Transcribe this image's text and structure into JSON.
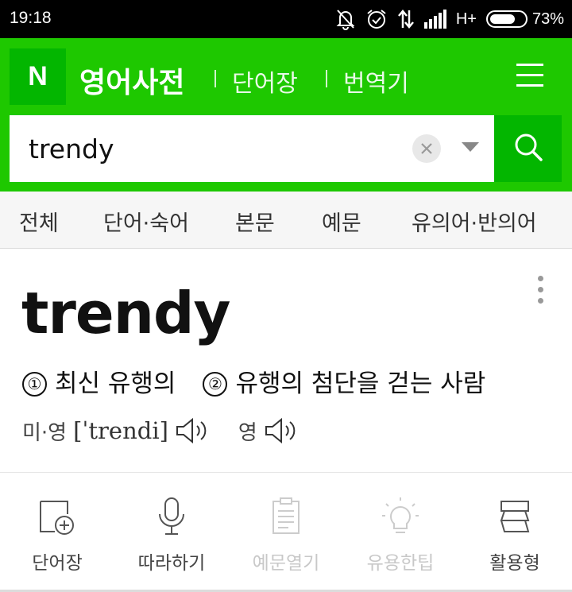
{
  "status_bar": {
    "time": "19:18",
    "network": "H+",
    "battery_percent": "73%",
    "battery_level": 0.73,
    "icons": [
      "notifications-muted-icon",
      "alarm-icon",
      "data-transfer-icon",
      "signal-icon",
      "battery-icon"
    ]
  },
  "header": {
    "logo": "N",
    "title": "영어사전",
    "links": [
      "단어장",
      "번역기"
    ],
    "menu_icon": "hamburger-menu-icon",
    "brand_color": "#1ec800"
  },
  "search": {
    "value": "trendy",
    "clear_icon": "close-icon",
    "dropdown_icon": "chevron-down-icon",
    "search_icon": "search-icon"
  },
  "tabs": [
    "전체",
    "단어·숙어",
    "본문",
    "예문",
    "유의어·반의어"
  ],
  "entry": {
    "word": "trendy",
    "meanings": [
      {
        "num": "①",
        "text": "최신 유행의"
      },
      {
        "num": "②",
        "text": "유행의 첨단을 걷는 사람"
      }
    ],
    "pronunciations": [
      {
        "label": "미·영",
        "phonetic": "[ˈtrendi]",
        "icon": "speaker-icon"
      },
      {
        "label": "영",
        "phonetic": "",
        "icon": "speaker-icon"
      }
    ],
    "more_icon": "more-vertical-icon"
  },
  "actions": [
    {
      "label": "단어장",
      "icon": "add-wordbook-icon",
      "enabled": true
    },
    {
      "label": "따라하기",
      "icon": "microphone-icon",
      "enabled": true
    },
    {
      "label": "예문열기",
      "icon": "document-icon",
      "enabled": false
    },
    {
      "label": "유용한팁",
      "icon": "lightbulb-icon",
      "enabled": false
    },
    {
      "label": "활용형",
      "icon": "conjugation-icon",
      "enabled": true
    }
  ]
}
